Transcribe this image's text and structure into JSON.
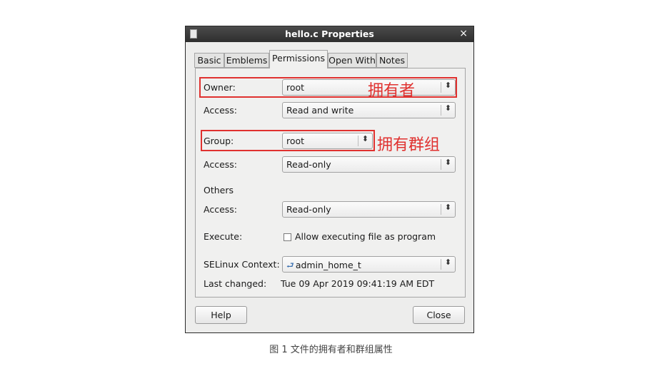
{
  "window": {
    "title": "hello.c Properties",
    "close_glyph": "×",
    "icon": "document-icon"
  },
  "tabs": [
    {
      "label": "Basic"
    },
    {
      "label": "Emblems"
    },
    {
      "label": "Permissions",
      "active": true
    },
    {
      "label": "Open With"
    },
    {
      "label": "Notes"
    }
  ],
  "owner": {
    "label": "Owner:",
    "value": "root",
    "annotation": "拥有者"
  },
  "owner_access": {
    "label": "Access:",
    "value": "Read and write"
  },
  "group": {
    "label": "Group:",
    "value": "root",
    "annotation": "拥有群组"
  },
  "group_access": {
    "label": "Access:",
    "value": "Read-only"
  },
  "others": {
    "heading": "Others",
    "access_label": "Access:",
    "access_value": "Read-only"
  },
  "execute": {
    "label": "Execute:",
    "checkbox_label": "Allow executing file as program",
    "checked": false
  },
  "selinux": {
    "label": "SELinux Context:",
    "value": "admin_home_t"
  },
  "last_changed": {
    "label": "Last changed:",
    "value": "Tue 09 Apr 2019 09:41:19 AM EDT"
  },
  "buttons": {
    "help": "Help",
    "close": "Close"
  },
  "caption": "图 1 文件的拥有者和群组属性",
  "colors": {
    "annotation_red": "#e0312f",
    "titlebar": "#2e2e2e"
  }
}
